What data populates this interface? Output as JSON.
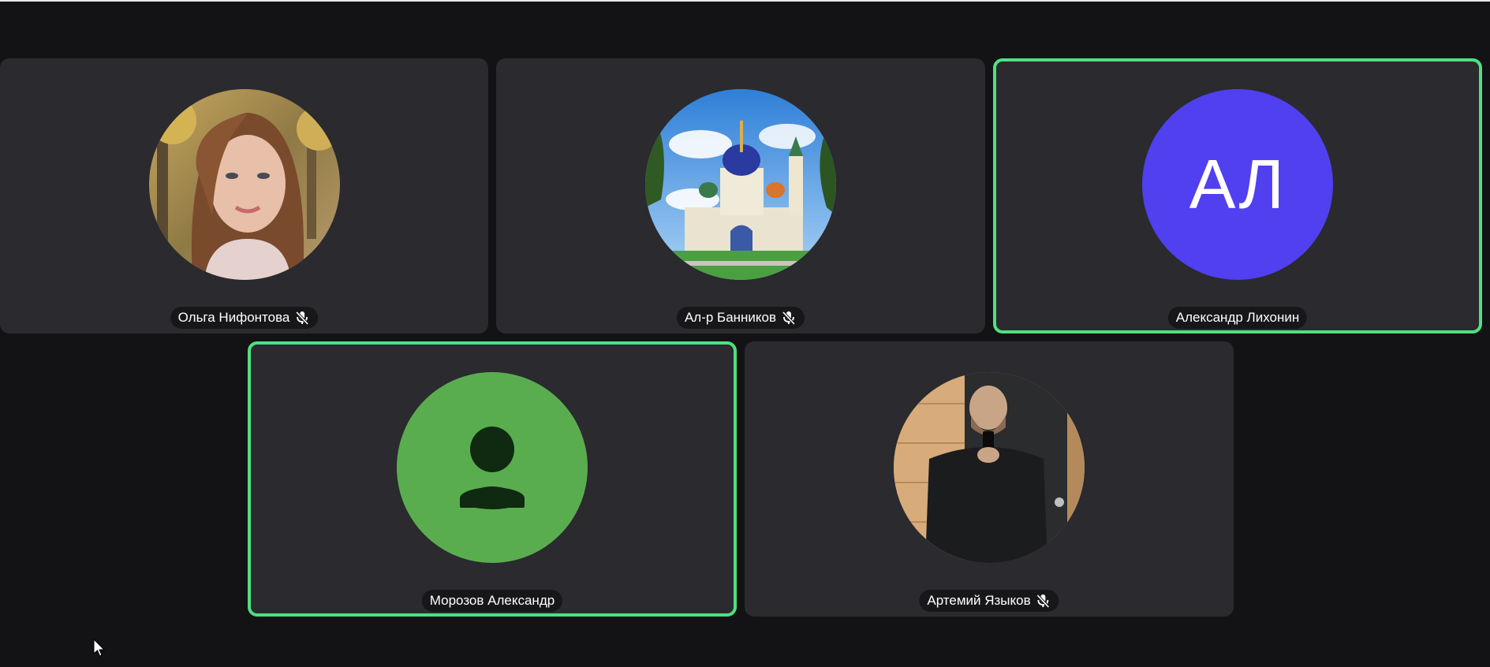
{
  "colors": {
    "background": "#131316",
    "tile": "#2a2a2f",
    "speaking_border": "#4fe07f",
    "pill": "#17171a",
    "initials_avatar": "#5040f0",
    "placeholder_avatar": "#5aad4f"
  },
  "participants": [
    {
      "name": "Ольга Нифонтова",
      "avatar": "photo-woman",
      "muted": true,
      "speaking": false
    },
    {
      "name": "Ал-р Банников",
      "avatar": "photo-church",
      "muted": true,
      "speaking": false
    },
    {
      "name": "Александр Лихонин",
      "avatar": "initials",
      "initials": "АЛ",
      "muted": false,
      "speaking": true
    },
    {
      "name": "Морозов Александр",
      "avatar": "person-placeholder-icon",
      "muted": false,
      "speaking": true
    },
    {
      "name": "Артемий Языков",
      "avatar": "photo-man",
      "muted": true,
      "speaking": false
    }
  ],
  "icons": {
    "muted": "mic-off-icon",
    "pointer": "cursor-icon"
  }
}
